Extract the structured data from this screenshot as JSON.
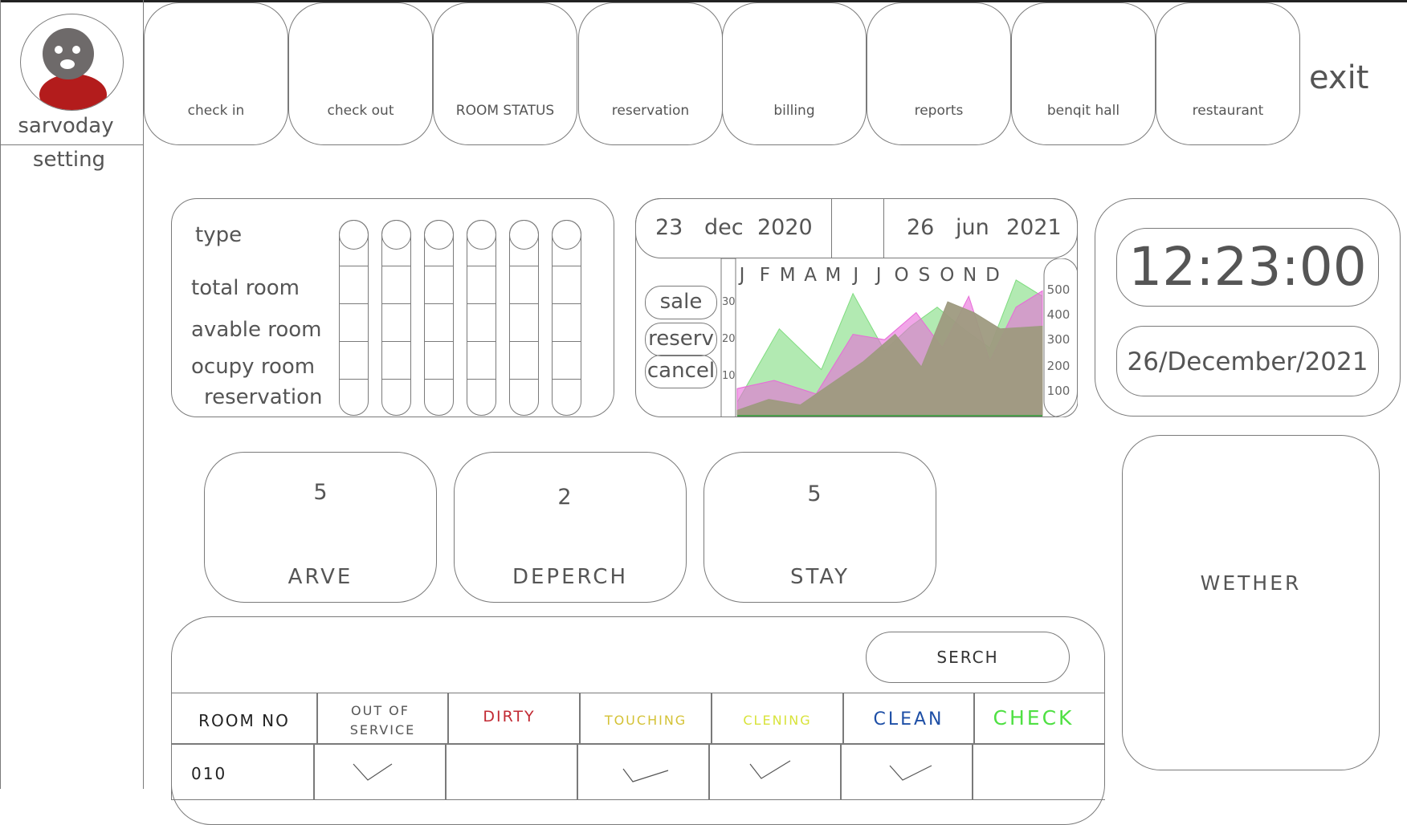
{
  "sidebar": {
    "user_name": "sarvoday",
    "setting_label": "setting"
  },
  "nav": {
    "items": [
      {
        "label": "check in"
      },
      {
        "label": "check out"
      },
      {
        "label": "ROOM STATUS"
      },
      {
        "label": "reservation"
      },
      {
        "label": "billing"
      },
      {
        "label": "reports"
      },
      {
        "label": "benqit hall"
      },
      {
        "label": "restaurant"
      }
    ],
    "exit_label": "exit"
  },
  "rooms_panel": {
    "rows": [
      "type",
      "total room",
      "avable room",
      "ocupy room",
      "reservation"
    ]
  },
  "date_range": {
    "from": {
      "day": "23",
      "month": "dec",
      "year": "2020"
    },
    "to": {
      "day": "26",
      "month": "jun",
      "year": "2021"
    }
  },
  "chart_buttons": [
    "sale",
    "reserv",
    "cancel"
  ],
  "chart_data": {
    "type": "area",
    "categories": [
      "J",
      "F",
      "M",
      "A",
      "M",
      "J",
      "J",
      "O",
      "S",
      "O",
      "N",
      "D"
    ],
    "left_axis_ticks": [
      "30",
      "20",
      "10"
    ],
    "right_axis_ticks": [
      "500",
      "400",
      "300",
      "200",
      "100"
    ],
    "ylim": [
      0,
      550
    ],
    "colors": {
      "green": "#7fdc7f",
      "pink": "#e86ad8",
      "olive": "#9e9a80"
    },
    "series": [
      {
        "x": [
          0,
          1.6,
          3.2,
          4.4,
          5.6,
          6.6,
          7.6,
          8.6,
          9.6,
          10.6,
          11.6
        ],
        "values": [
          50,
          320,
          170,
          450,
          240,
          330,
          400,
          320,
          250,
          500,
          440
        ]
      },
      {
        "x": [
          0,
          1.4,
          3,
          4.4,
          5.6,
          6.8,
          7.8,
          8.8,
          9.6,
          10.6,
          11.6
        ],
        "values": [
          100,
          130,
          80,
          300,
          280,
          380,
          250,
          440,
          200,
          400,
          460
        ]
      },
      {
        "x": [
          0,
          1.2,
          2.4,
          3.6,
          4.8,
          6,
          7,
          8,
          9,
          10,
          11.6
        ],
        "values": [
          20,
          60,
          40,
          120,
          200,
          300,
          180,
          420,
          380,
          320,
          330
        ]
      }
    ]
  },
  "clock": {
    "time": "12:23:00",
    "date": "26/December/2021"
  },
  "stats": [
    {
      "value": "5",
      "label": "ARVE"
    },
    {
      "value": "2",
      "label": "DEPERCH"
    },
    {
      "value": "5",
      "label": "STAY"
    }
  ],
  "weather_label": "WETHER",
  "table": {
    "search_label": "SERCH",
    "headers": [
      {
        "line1": "ROOM NO",
        "line2": "",
        "color": "#222222"
      },
      {
        "line1": "OUT OF",
        "line2": "SERVICE",
        "color": "#555555"
      },
      {
        "line1": "DIRTY",
        "line2": "",
        "color": "#c22a33"
      },
      {
        "line1": "TOUCHING",
        "line2": "",
        "color": "#d4c236"
      },
      {
        "line1": "CLENING",
        "line2": "",
        "color": "#d8e33a"
      },
      {
        "line1": "CLEAN",
        "line2": "",
        "color": "#1e4fa6"
      },
      {
        "line1": "CHECK",
        "line2": "",
        "color": "#4fe043"
      }
    ],
    "rows": [
      {
        "room_no": "010",
        "checks": [
          true,
          false,
          true,
          true,
          true,
          false
        ]
      }
    ]
  }
}
